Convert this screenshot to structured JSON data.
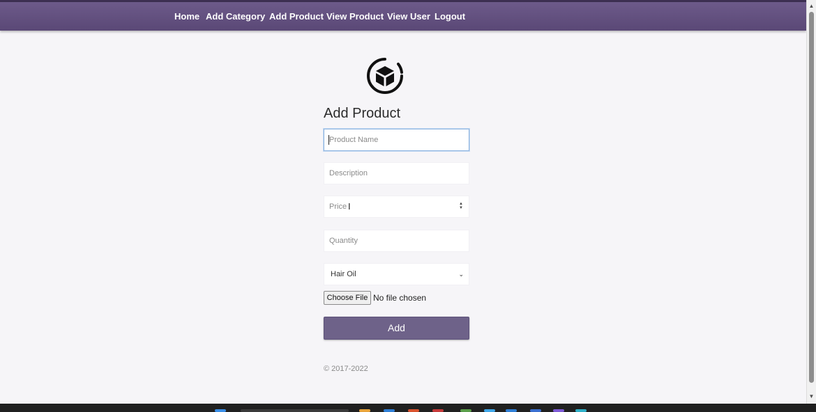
{
  "nav": {
    "items": [
      {
        "label": "Home"
      },
      {
        "label": "Add Category"
      },
      {
        "label": "Add Product"
      },
      {
        "label": "View Product"
      },
      {
        "label": "View User"
      },
      {
        "label": "Logout"
      }
    ]
  },
  "logo": {
    "icon": "cube-box-icon"
  },
  "form": {
    "title": "Add Product",
    "product_name_placeholder": "Product Name",
    "description_placeholder": "Description",
    "price_placeholder": "Price",
    "quantity_placeholder": "Quantity",
    "category_selected": "Hair Oil",
    "file_button_label": "Choose File",
    "file_status": "No file chosen",
    "submit_label": "Add"
  },
  "footer": {
    "copyright": "© 2017-2022"
  },
  "colors": {
    "navbar": "#5f4d7c",
    "button": "#6e6289",
    "background": "#f6f5f8"
  }
}
